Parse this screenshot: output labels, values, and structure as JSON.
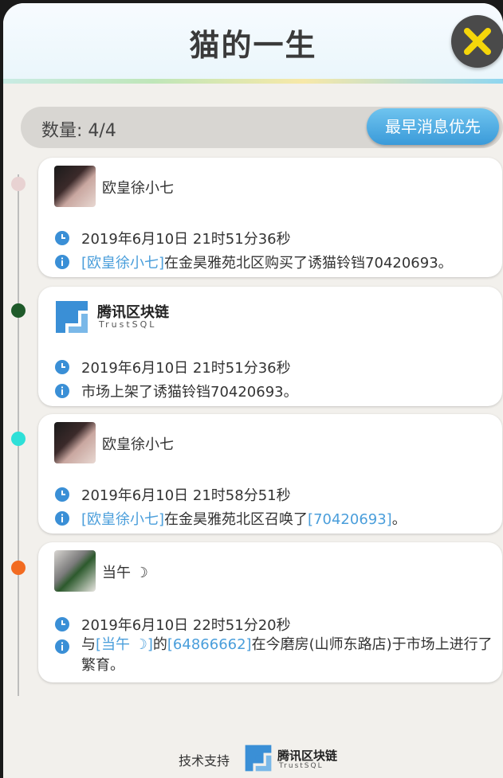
{
  "title": "猫的一生",
  "close_icon": "close-x-icon",
  "count": {
    "label": "数量: 4/4"
  },
  "sort_button": {
    "label": "最早消息优先"
  },
  "timeline_colors": [
    "#e8d2d2",
    "#1f5a2a",
    "#2ee0d8",
    "#f26b21"
  ],
  "events": [
    {
      "actor_type": "user",
      "actor_name": "欧皇徐小七",
      "time": "2019年6月10日 21时51分36秒",
      "desc_link": "[欧皇徐小七]",
      "desc_rest": "在金昊雅苑北区购买了诱猫铃铛70420693。"
    },
    {
      "actor_type": "system",
      "logo_title": "腾讯区块链",
      "logo_sub": "TrustSQL",
      "time": "2019年6月10日 21时51分36秒",
      "desc_rest": "市场上架了诱猫铃铛70420693。"
    },
    {
      "actor_type": "user",
      "actor_name": "欧皇徐小七",
      "time": "2019年6月10日 21时58分51秒",
      "desc_link": "[欧皇徐小七]",
      "desc_mid": "在金昊雅苑北区召唤了",
      "desc_link2": "[70420693]",
      "desc_end": "。"
    },
    {
      "actor_type": "user",
      "actor_name": "当午 ☽",
      "time": "2019年6月10日 22时51分20秒",
      "desc_pre": "与",
      "desc_link": "[当午 ☽]",
      "desc_mid": "的",
      "desc_link2": "[64866662]",
      "desc_end": "在今磨房(山师东路店)于市场上进行了繁育。"
    }
  ],
  "footer": {
    "label": "技术支持",
    "logo_title": "腾讯区块链",
    "logo_sub": "TrustSQL"
  },
  "colors": {
    "link": "#4a9edb",
    "button": "#3a9ad9",
    "close_x": "#f5d60a"
  }
}
